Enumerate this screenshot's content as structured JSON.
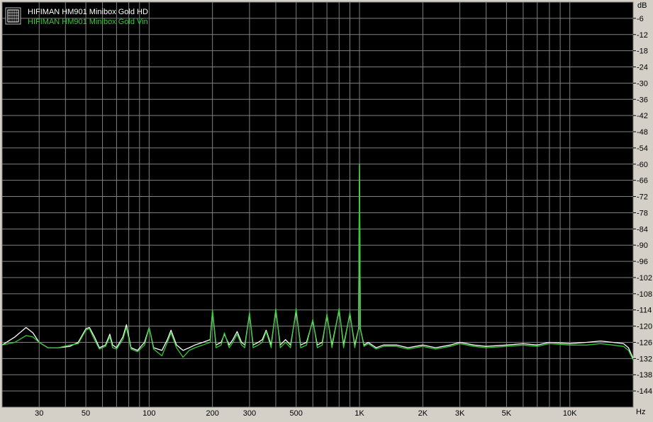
{
  "colors": {
    "plot_background": "#000000",
    "frame_background": "#d4d0c8",
    "grid": "#808080",
    "series_white": "#ffffff",
    "series_green": "#33cc33"
  },
  "legend": {
    "icon": "grid-chart-icon",
    "entries": [
      {
        "label": "HIFIMAN HM901 Minibox Gold HD",
        "color": "#ffffff"
      },
      {
        "label": "HIFIMAN HM901 Minibox  Gold Vin",
        "color": "#33cc33"
      }
    ]
  },
  "chart_data": {
    "type": "line",
    "title": "",
    "xscale": "log",
    "xlim": [
      20,
      20000
    ],
    "ylim": [
      -150,
      0
    ],
    "xunit": "Hz",
    "yunit": "dB",
    "grid": true,
    "legend_position": "top-left",
    "x_ticks": [
      {
        "value": 30,
        "label": "30"
      },
      {
        "value": 50,
        "label": "50"
      },
      {
        "value": 100,
        "label": "100"
      },
      {
        "value": 200,
        "label": "200"
      },
      {
        "value": 300,
        "label": "300"
      },
      {
        "value": 500,
        "label": "500"
      },
      {
        "value": 1000,
        "label": "1K"
      },
      {
        "value": 2000,
        "label": "2K"
      },
      {
        "value": 3000,
        "label": "3K"
      },
      {
        "value": 5000,
        "label": "5K"
      },
      {
        "value": 10000,
        "label": "10K"
      }
    ],
    "y_ticks": [
      -6,
      -12,
      -18,
      -24,
      -30,
      -36,
      -42,
      -48,
      -54,
      -60,
      -66,
      -72,
      -78,
      -84,
      -90,
      -96,
      -102,
      -108,
      -114,
      -120,
      -126,
      -132,
      -138,
      -144
    ],
    "series": [
      {
        "name": "HIFIMAN HM901 Minibox Gold HD",
        "color": "#ffffff",
        "points": [
          [
            20,
            -127
          ],
          [
            23,
            -124
          ],
          [
            26,
            -120.5
          ],
          [
            28,
            -122.5
          ],
          [
            30,
            -126
          ],
          [
            33,
            -128
          ],
          [
            37,
            -128
          ],
          [
            42,
            -127.5
          ],
          [
            46,
            -126
          ],
          [
            50,
            -121
          ],
          [
            52,
            -120.5
          ],
          [
            55,
            -124
          ],
          [
            58,
            -128
          ],
          [
            62,
            -127
          ],
          [
            65,
            -123
          ],
          [
            67,
            -127
          ],
          [
            70,
            -128
          ],
          [
            75,
            -124
          ],
          [
            78,
            -119.5
          ],
          [
            82,
            -128
          ],
          [
            88,
            -129
          ],
          [
            95,
            -126
          ],
          [
            100,
            -120.5
          ],
          [
            105,
            -128
          ],
          [
            115,
            -129
          ],
          [
            122,
            -125
          ],
          [
            127,
            -121.5
          ],
          [
            135,
            -127
          ],
          [
            145,
            -129
          ],
          [
            155,
            -128
          ],
          [
            165,
            -127
          ],
          [
            180,
            -126
          ],
          [
            195,
            -125
          ],
          [
            200,
            -114.5
          ],
          [
            208,
            -127
          ],
          [
            220,
            -126
          ],
          [
            228,
            -123
          ],
          [
            240,
            -127
          ],
          [
            250,
            -125
          ],
          [
            262,
            -122
          ],
          [
            275,
            -126
          ],
          [
            285,
            -127
          ],
          [
            300,
            -115.5
          ],
          [
            312,
            -127
          ],
          [
            330,
            -126
          ],
          [
            345,
            -125
          ],
          [
            360,
            -121.5
          ],
          [
            380,
            -127
          ],
          [
            400,
            -114
          ],
          [
            420,
            -127
          ],
          [
            445,
            -125
          ],
          [
            470,
            -127
          ],
          [
            500,
            -114.5
          ],
          [
            525,
            -127
          ],
          [
            560,
            -126
          ],
          [
            600,
            -118
          ],
          [
            630,
            -127
          ],
          [
            665,
            -126
          ],
          [
            700,
            -116
          ],
          [
            740,
            -127
          ],
          [
            800,
            -114
          ],
          [
            840,
            -127
          ],
          [
            900,
            -115.5
          ],
          [
            950,
            -127
          ],
          [
            990,
            -121
          ],
          [
            1000,
            -60
          ],
          [
            1010,
            -121
          ],
          [
            1050,
            -127
          ],
          [
            1100,
            -126
          ],
          [
            1200,
            -128
          ],
          [
            1300,
            -127
          ],
          [
            1500,
            -127
          ],
          [
            1700,
            -128
          ],
          [
            2000,
            -127
          ],
          [
            2300,
            -128
          ],
          [
            2700,
            -127
          ],
          [
            3000,
            -126
          ],
          [
            3500,
            -127
          ],
          [
            4000,
            -127.5
          ],
          [
            5000,
            -127
          ],
          [
            6000,
            -126.5
          ],
          [
            7000,
            -127
          ],
          [
            8000,
            -126
          ],
          [
            10000,
            -126.5
          ],
          [
            12000,
            -126
          ],
          [
            14000,
            -125.5
          ],
          [
            16000,
            -126
          ],
          [
            18000,
            -126.5
          ],
          [
            19000,
            -128
          ],
          [
            20000,
            -132
          ]
        ]
      },
      {
        "name": "HIFIMAN HM901 Minibox  Gold Vin",
        "color": "#33cc33",
        "points": [
          [
            20,
            -127
          ],
          [
            23,
            -126
          ],
          [
            26,
            -123.5
          ],
          [
            28,
            -124
          ],
          [
            30,
            -126
          ],
          [
            33,
            -128
          ],
          [
            37,
            -128
          ],
          [
            42,
            -127
          ],
          [
            46,
            -126.5
          ],
          [
            50,
            -121.5
          ],
          [
            52,
            -121
          ],
          [
            55,
            -125
          ],
          [
            58,
            -128.5
          ],
          [
            62,
            -127.5
          ],
          [
            65,
            -124
          ],
          [
            67,
            -128
          ],
          [
            70,
            -128.5
          ],
          [
            75,
            -125
          ],
          [
            78,
            -120.5
          ],
          [
            82,
            -128.5
          ],
          [
            88,
            -129.5
          ],
          [
            95,
            -127
          ],
          [
            100,
            -120.5
          ],
          [
            105,
            -128.5
          ],
          [
            115,
            -131
          ],
          [
            122,
            -126
          ],
          [
            127,
            -122.5
          ],
          [
            135,
            -128
          ],
          [
            145,
            -131.5
          ],
          [
            155,
            -129
          ],
          [
            165,
            -128
          ],
          [
            180,
            -127
          ],
          [
            195,
            -126
          ],
          [
            200,
            -114
          ],
          [
            208,
            -128
          ],
          [
            220,
            -127
          ],
          [
            228,
            -122.5
          ],
          [
            240,
            -128
          ],
          [
            250,
            -126
          ],
          [
            262,
            -123
          ],
          [
            275,
            -127
          ],
          [
            285,
            -128
          ],
          [
            300,
            -115
          ],
          [
            312,
            -128
          ],
          [
            330,
            -127
          ],
          [
            345,
            -126
          ],
          [
            360,
            -122
          ],
          [
            380,
            -128
          ],
          [
            400,
            -113.5
          ],
          [
            420,
            -128
          ],
          [
            445,
            -126
          ],
          [
            470,
            -128
          ],
          [
            500,
            -113.5
          ],
          [
            525,
            -128
          ],
          [
            560,
            -127
          ],
          [
            600,
            -117.5
          ],
          [
            630,
            -128
          ],
          [
            665,
            -127
          ],
          [
            700,
            -115.5
          ],
          [
            740,
            -128
          ],
          [
            800,
            -113.5
          ],
          [
            840,
            -128
          ],
          [
            900,
            -115
          ],
          [
            950,
            -128
          ],
          [
            990,
            -121
          ],
          [
            1000,
            -60
          ],
          [
            1010,
            -121
          ],
          [
            1050,
            -127.5
          ],
          [
            1100,
            -126.5
          ],
          [
            1200,
            -128.5
          ],
          [
            1300,
            -127.5
          ],
          [
            1500,
            -127.5
          ],
          [
            1700,
            -128.5
          ],
          [
            2000,
            -127.5
          ],
          [
            2300,
            -128.5
          ],
          [
            2700,
            -127.5
          ],
          [
            3000,
            -126.5
          ],
          [
            3500,
            -127.5
          ],
          [
            4000,
            -128
          ],
          [
            5000,
            -127.5
          ],
          [
            6000,
            -127
          ],
          [
            7000,
            -127.5
          ],
          [
            8000,
            -126.5
          ],
          [
            10000,
            -127
          ],
          [
            12000,
            -127
          ],
          [
            14000,
            -126.5
          ],
          [
            16000,
            -127
          ],
          [
            18000,
            -127.5
          ],
          [
            19000,
            -129
          ],
          [
            20000,
            -132.5
          ]
        ]
      }
    ]
  }
}
